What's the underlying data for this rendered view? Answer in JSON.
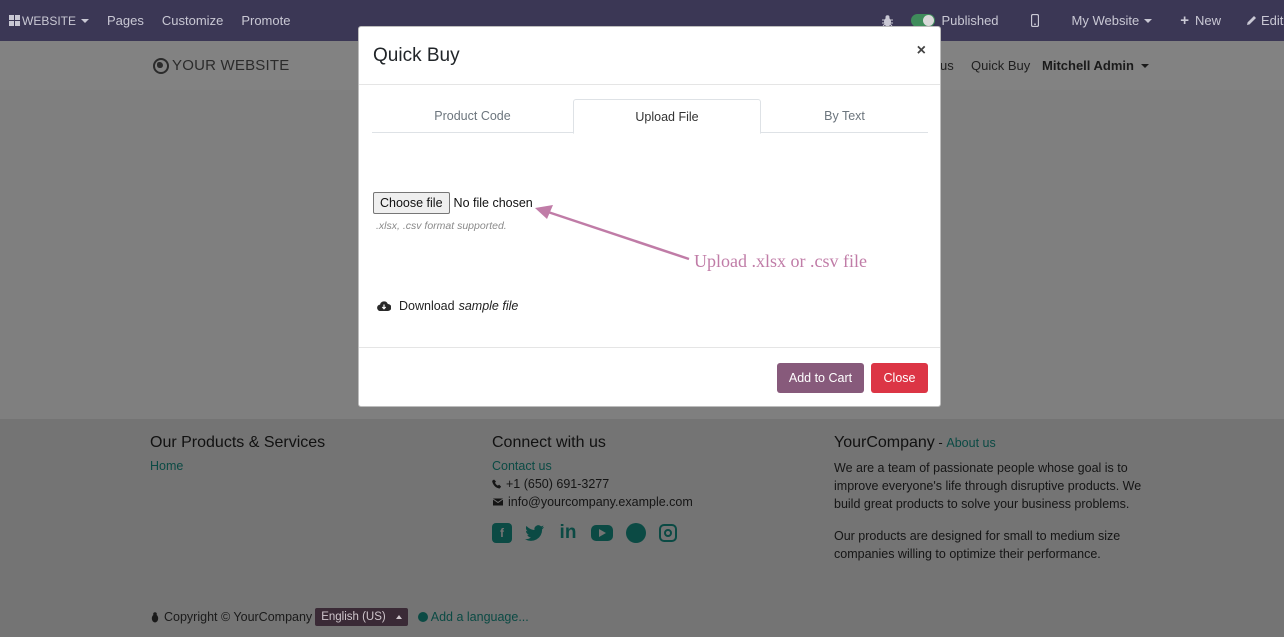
{
  "topbar": {
    "website_menu": "WEBSITE",
    "pages": "Pages",
    "customize": "Customize",
    "promote": "Promote",
    "published": "Published",
    "my_website": "My Website",
    "new": "New",
    "edit": "Edit"
  },
  "header": {
    "logo": "YOUR WEBSITE",
    "nav_partial": "us",
    "quick_buy": "Quick Buy",
    "user": "Mitchell Admin"
  },
  "modal": {
    "title": "Quick Buy",
    "close_glyph": "×",
    "tabs": [
      {
        "label": "Product Code",
        "active": false
      },
      {
        "label": "Upload File",
        "active": true
      },
      {
        "label": "By Text",
        "active": false
      }
    ],
    "choose_file": "Choose file",
    "no_file": "No file chosen",
    "hint": ".xlsx, .csv format supported.",
    "annotation": "Upload .xlsx or .csv file",
    "download_prefix": "Download",
    "download_link": "sample file",
    "add_to_cart": "Add to Cart",
    "close": "Close"
  },
  "footer": {
    "col1": {
      "title": "Our Products & Services",
      "links": [
        "Home"
      ]
    },
    "col2": {
      "title": "Connect with us",
      "contact": "Contact us",
      "phone": "+1 (650) 691-3277",
      "email": "info@yourcompany.example.com",
      "socials": [
        "facebook-icon",
        "twitter-icon",
        "linkedin-icon",
        "youtube-icon",
        "github-icon",
        "instagram-icon"
      ]
    },
    "col3": {
      "company": "YourCompany",
      "separator": " - ",
      "about_link": "About us",
      "para1": "We are a team of passionate people whose goal is to improve everyone's life through disruptive products. We build great products to solve your business problems.",
      "para2": "Our products are designed for small to medium size companies willing to optimize their performance."
    },
    "copyright": "Copyright © YourCompany",
    "language": "English (US)",
    "add_language": "Add a language..."
  },
  "colors": {
    "admin_bar": "#3b3755",
    "primary": "#875a7b",
    "danger": "#dc3545",
    "annotation": "#c07ca7"
  }
}
